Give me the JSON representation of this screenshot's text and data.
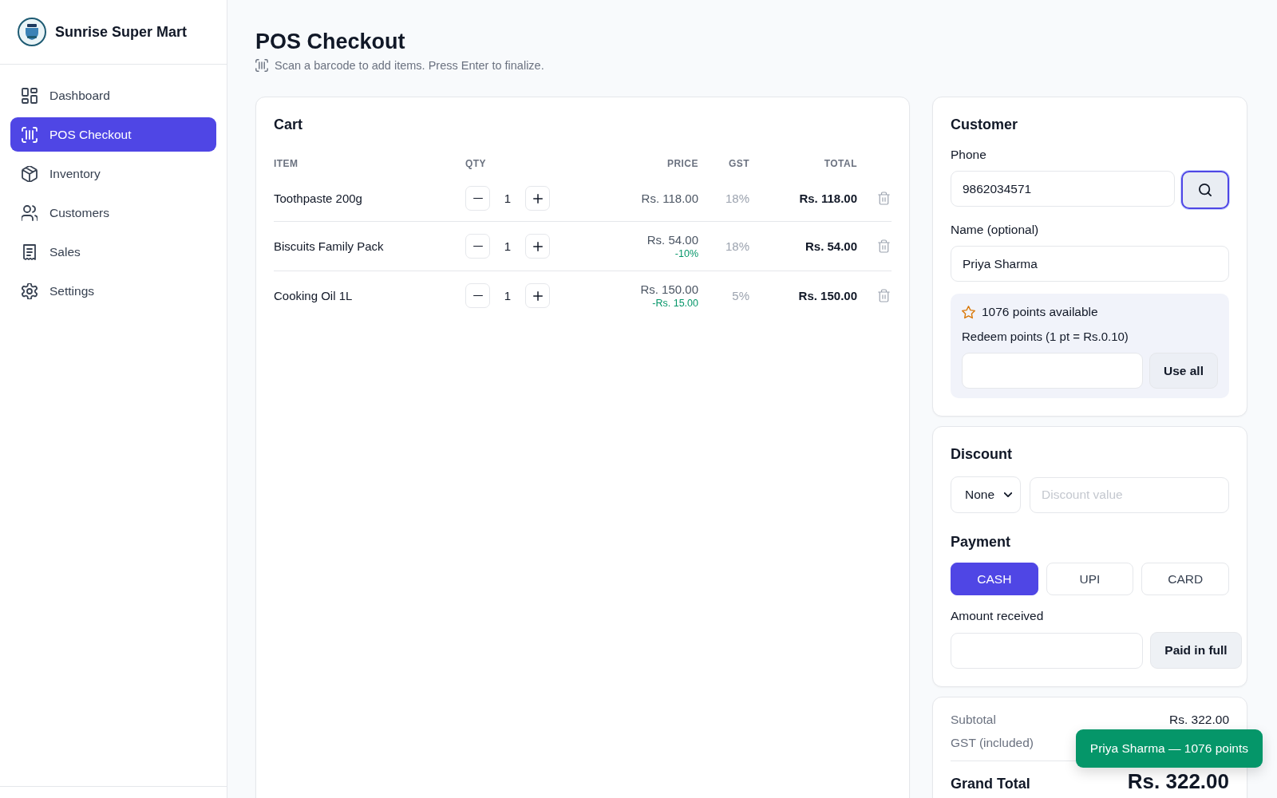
{
  "sidebar": {
    "brand": "Sunrise Super Mart",
    "items": [
      {
        "label": "Dashboard",
        "selected": false
      },
      {
        "label": "POS Checkout",
        "selected": true
      },
      {
        "label": "Inventory",
        "selected": false
      },
      {
        "label": "Customers",
        "selected": false
      },
      {
        "label": "Sales",
        "selected": false
      },
      {
        "label": "Settings",
        "selected": false
      }
    ]
  },
  "header": {
    "title": "POS Checkout",
    "hint": "Scan a barcode to add items. Press Enter to finalize."
  },
  "cart": {
    "title": "Cart",
    "columns": [
      "ITEM",
      "QTY",
      "PRICE",
      "GST",
      "TOTAL"
    ],
    "rows": [
      {
        "item": "Toothpaste 200g",
        "qty": "1",
        "price": "Rs. 118.00",
        "gst": "18%",
        "total": "Rs. 118.00"
      },
      {
        "item": "Biscuits Family Pack",
        "qty": "1",
        "price": "Rs. 54.00",
        "discount": "-10%",
        "gst": "18%",
        "total": "Rs. 54.00"
      },
      {
        "item": "Cooking Oil 1L",
        "qty": "1",
        "price": "Rs. 150.00",
        "discount": "-Rs. 15.00",
        "gst": "5%",
        "total": "Rs. 150.00"
      }
    ]
  },
  "customer": {
    "title": "Customer",
    "phone_label": "Phone",
    "phone": "9862034571",
    "search_focused": true,
    "name_label": "Name (optional)",
    "name": "Priya Sharma",
    "loyalty": {
      "points": "1076 points available",
      "redeem_label": "Redeem points (1 pt = Rs.0.10)",
      "use_all": "Use all"
    }
  },
  "discount": {
    "title": "Discount",
    "type": "None",
    "placeholder": "Discount value"
  },
  "payment": {
    "title": "Payment",
    "methods": [
      {
        "label": "CASH",
        "selected": true
      },
      {
        "label": "UPI",
        "selected": false
      },
      {
        "label": "CARD",
        "selected": false
      }
    ],
    "amount_label": "Amount received",
    "paid_in_full": "Paid in full"
  },
  "totals": {
    "subtotal_label": "Subtotal",
    "subtotal": "Rs. 322.00",
    "gst_label": "GST (included)",
    "grand_total_label": "Grand Total",
    "grand_total": "Rs. 322.00"
  },
  "toast": {
    "message": "Priya Sharma — 1076 points"
  }
}
